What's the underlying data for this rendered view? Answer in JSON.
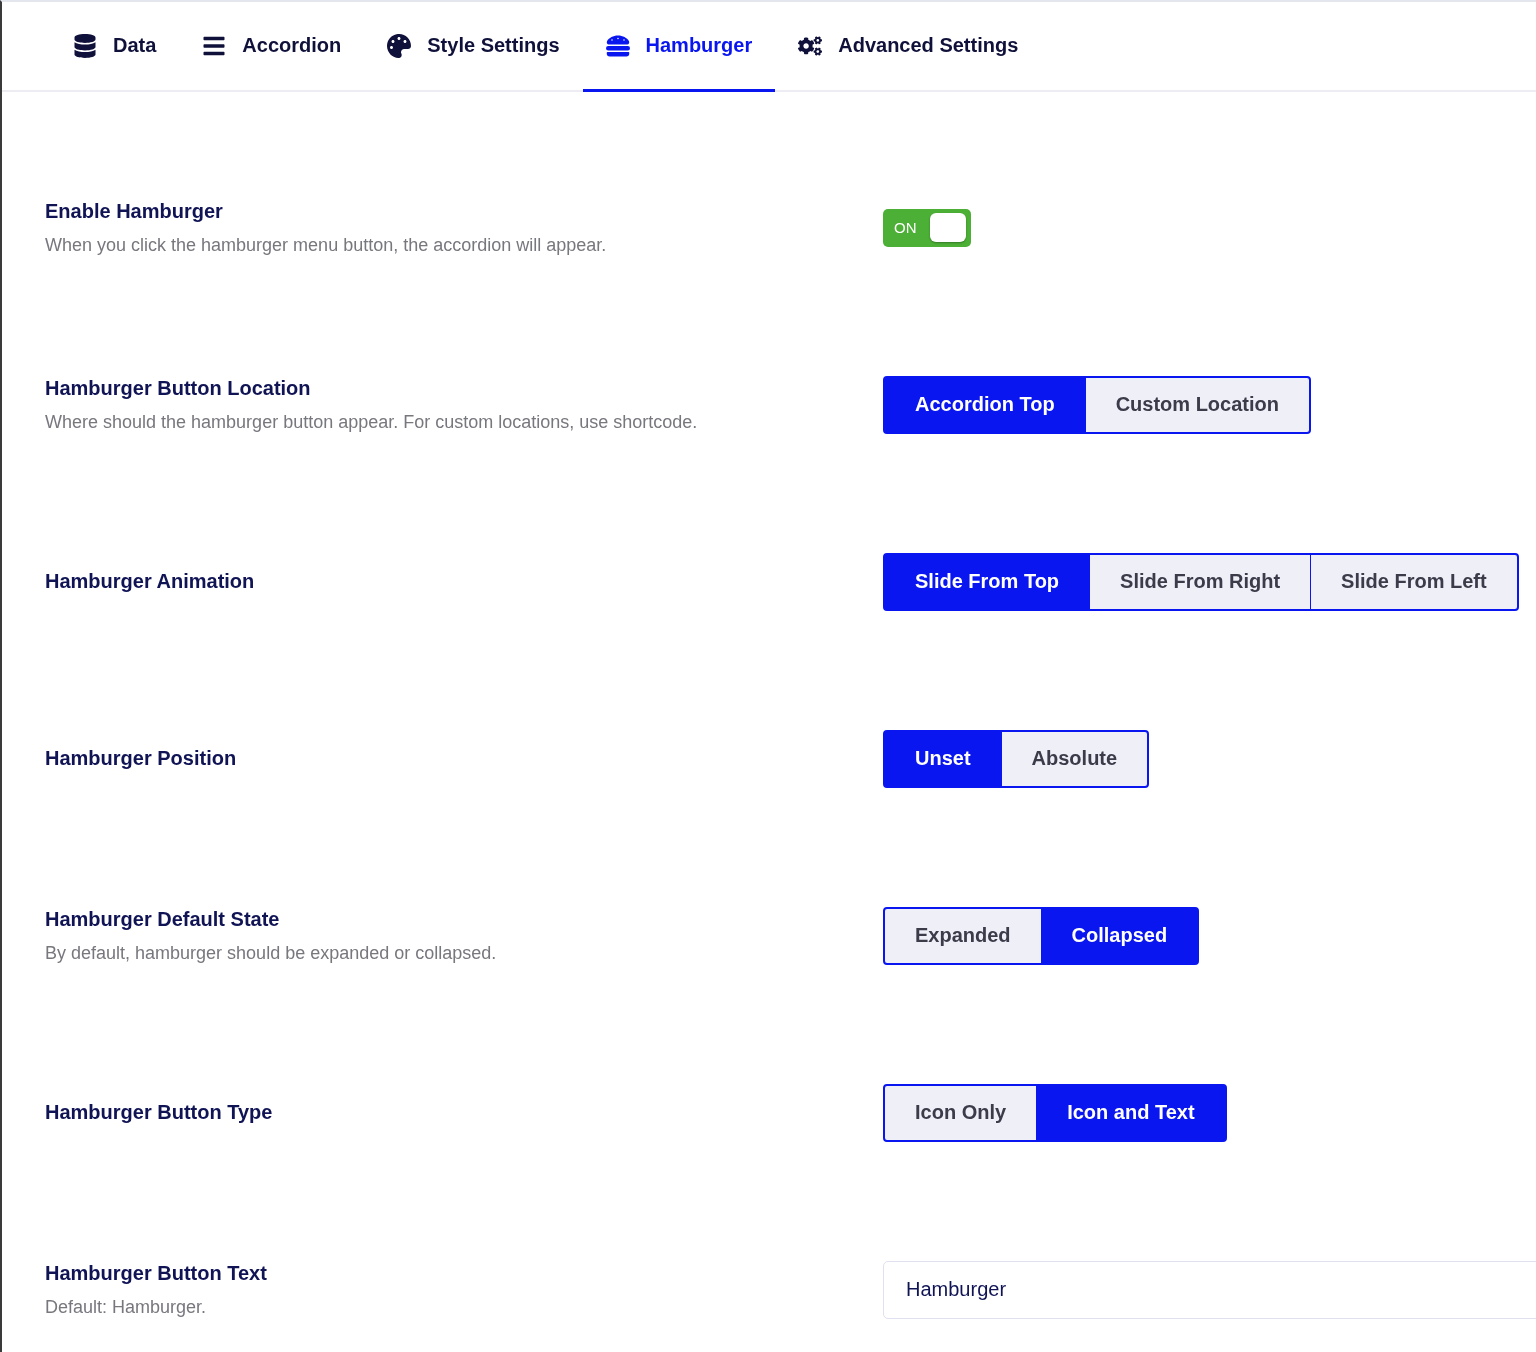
{
  "tabs": [
    {
      "label": "Data",
      "kind": "database",
      "selected": false
    },
    {
      "label": "Accordion",
      "kind": "bars",
      "selected": false
    },
    {
      "label": "Style Settings",
      "kind": "palette",
      "selected": false
    },
    {
      "label": "Hamburger",
      "kind": "hamburger",
      "selected": true
    },
    {
      "label": "Advanced Settings",
      "kind": "cogs",
      "selected": false
    }
  ],
  "settings": [
    {
      "kind": "toggle",
      "title": "Enable Hamburger",
      "description": "When you click the hamburger menu button, the accordion will appear.",
      "on": true,
      "label": "ON"
    },
    {
      "kind": "segmented",
      "title": "Hamburger Button Location",
      "description": "Where should the hamburger button appear. For custom locations, use shortcode.",
      "options": [
        {
          "label": "Accordion Top",
          "selected": true
        },
        {
          "label": "Custom Location",
          "selected": false
        }
      ]
    },
    {
      "kind": "segmented",
      "title": "Hamburger Animation",
      "options": [
        {
          "label": "Slide From Top",
          "selected": true
        },
        {
          "label": "Slide From Right",
          "selected": false
        },
        {
          "label": "Slide From Left",
          "selected": false
        }
      ]
    },
    {
      "kind": "segmented",
      "title": "Hamburger Position",
      "options": [
        {
          "label": "Unset",
          "selected": true
        },
        {
          "label": "Absolute",
          "selected": false
        }
      ]
    },
    {
      "kind": "segmented",
      "title": "Hamburger Default State",
      "description": "By default, hamburger should be expanded or collapsed.",
      "options": [
        {
          "label": "Expanded",
          "selected": false
        },
        {
          "label": "Collapsed",
          "selected": true
        }
      ]
    },
    {
      "kind": "segmented",
      "title": "Hamburger Button Type",
      "options": [
        {
          "label": "Icon Only",
          "selected": false
        },
        {
          "label": "Icon and Text",
          "selected": true
        }
      ]
    },
    {
      "kind": "text",
      "title": "Hamburger Button Text",
      "description": "Default: Hamburger.",
      "value": "Hamburger"
    }
  ]
}
